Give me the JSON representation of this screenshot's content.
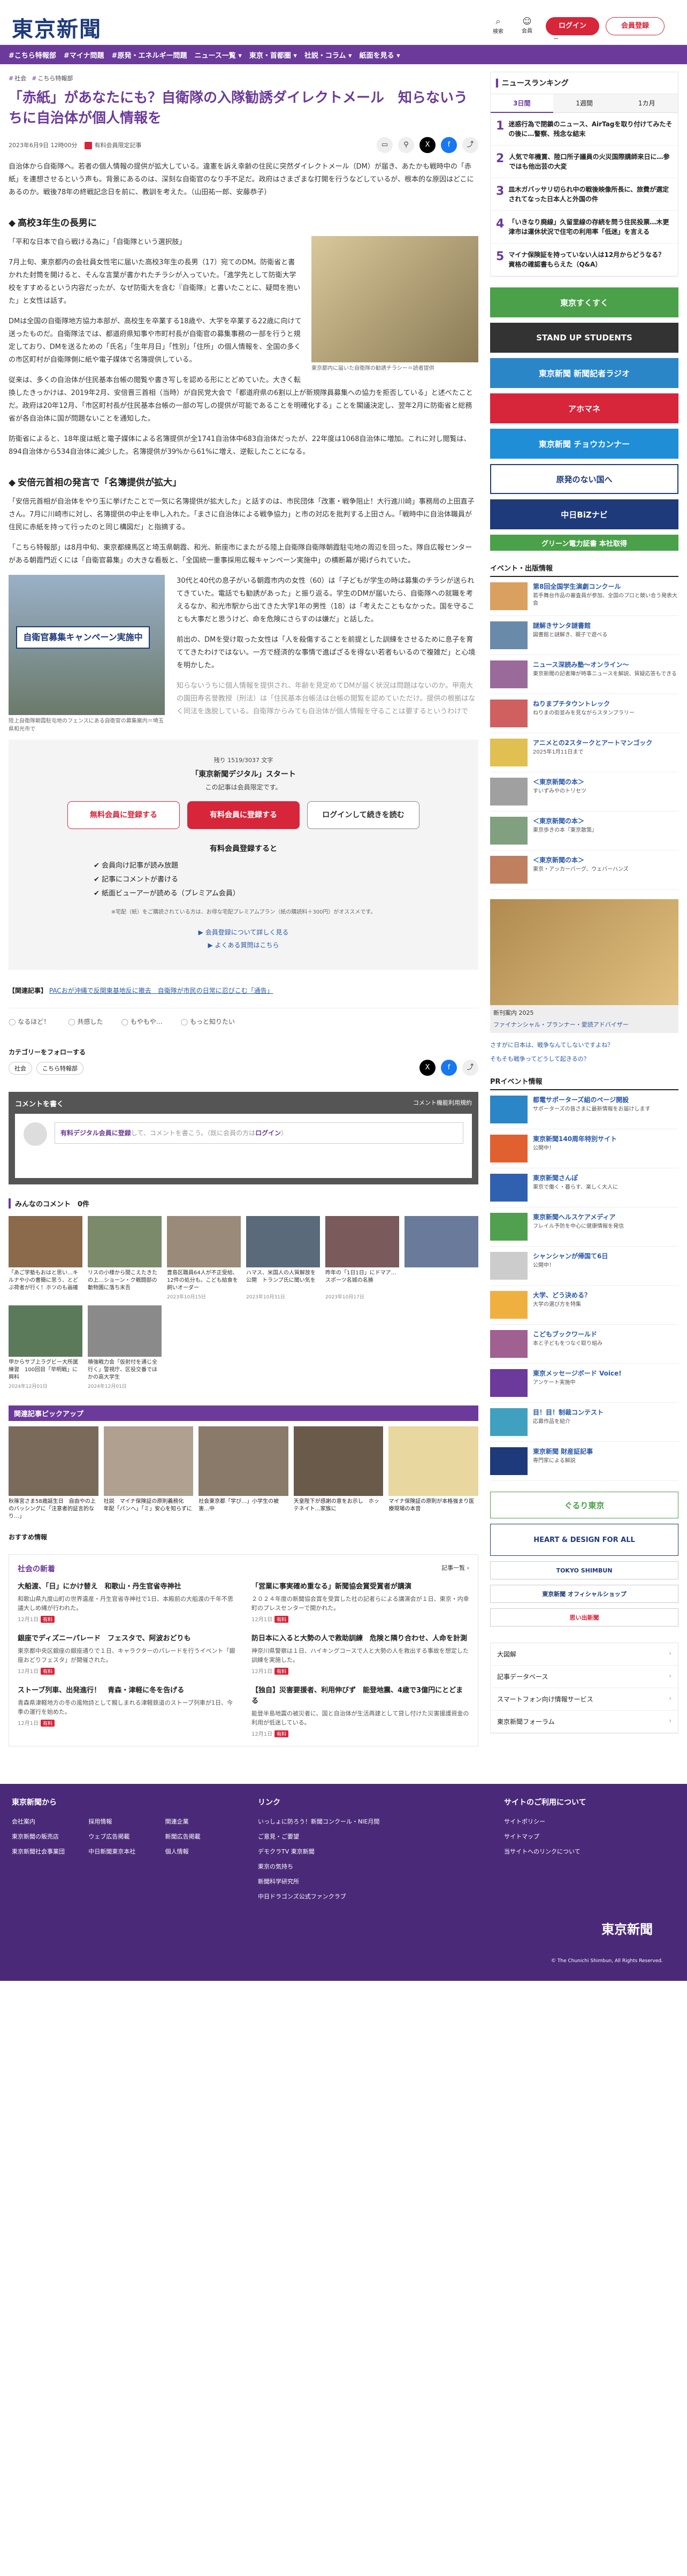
{
  "header": {
    "logo": "東京新聞",
    "icons": [
      {
        "label": "検索",
        "glyph": "⌕"
      },
      {
        "label": "会員",
        "glyph": "☺"
      },
      {
        "label": "メニュー",
        "glyph": "≡"
      }
    ],
    "login": "ログイン",
    "register": "会員登録"
  },
  "nav": [
    "#こちら特報部",
    "#マイナ問題",
    "#原発・エネルギー問題",
    "ニュース一覧 ▾",
    "東京・首都圏 ▾",
    "社説・コラム ▾",
    "紙面を見る ▾"
  ],
  "article": {
    "tags": [
      "社会",
      "こちら特報部"
    ],
    "title": "「赤紙」があなたにも？自衛隊の入隊勧誘ダイレクトメール　知らないうちに自治体が個人情報を",
    "date": "2023年6月9日 12時00分",
    "members_only": "有料会員限定記事",
    "p1": "自治体から自衛隊へ。若者の個人情報の提供が拡大している。違憲を訴え幸齢の住民に突然ダイレクトメール（DM）が届き、あたかも戦時中の「赤紙」を連想させるという声も。背景にあるのは、深刻な自衛官のなり手不足だ。政府はさまざまな打開を行うなどしているが、根本的な原因はどこにあるのか。戦後78年の終戦記念日を前に、教訓を考えた。（山田祐一郎、安藤恭子）",
    "h1": "高校3年生の長男に",
    "quote1": "「平和な日本で自ら戦ける為に」「自衛隊という選択肢」",
    "fig1_caption": "東京都内に届いた自衛隊の勧誘チラシー＝読者提供",
    "p2": "7月上旬、東京都内の会社員女性宅に届いた高校3年生の長男（17）宛てのDM。防衛省と書かれた封筒を開けると、そんな言葉が書かれたチラシが入っていた。「進学先として防衛大学校をすすめるという内容だったが、なぜ防衛大を含む『自衛隊』と書いたことに、疑問を抱いた」と女性は話す。",
    "p3": "DMは全国の自衛隊地方協力本部が、高校生を卒業する18歳や、大学を卒業する22歳に向けて送ったものだ。自衛隊法では、都道府県知事や市町村長が自衛官の募集事務の一部を行うと規定しており、DMを送るための「氏名」「生年月日」「性別」「住所」の個人情報を、全国の多くの市区町村が自衛隊側に紙や電子媒体で名簿提供している。",
    "p4": "従来は、多くの自治体が住民基本台帳の閲覧や書き写しを認める形にとどめていた。大きく転換したきっかけは、2019年2月、安倍晋三首相（当時）が自民党大会で「都道府県の6割以上が新規隊員募集への協力を拒否している」と述べたことだ。政府は20年12月、「市区町村長が住民基本台帳の一部の写しの提供が可能であることを明確化する」ことを閣議決定し、翌年2月に防衛省と総務省が各自治体に国が問題ないことを通知した。",
    "p5": "防衛省によると、18年度は紙と電子媒体による名簿提供が全1741自治体中683自治体だったが、22年度は1068自治体に増加。これに対し閲覧は、894自治体から534自治体に減少した。名簿提供が39%から61%に増え、逆転したことになる。",
    "h2": "安倍元首相の発言で「名簿提供が拡大」",
    "p6": "「安倍元首相が自治体をやり玉に挙げたことで一気に名簿提供が拡大した」と話すのは、市民団体「改憲・戦争阻止！大行進川崎」事務局の上田直子さん。7月に川崎市に対し、名簿提供の中止を申し入れた。「まさに自治体による戦争協力」と市の対応を批判する上田さん。「戦時中に自治体職員が住民に赤紙を持って行ったのと同じ構図だ」と指摘する。",
    "p7": "「こちら特報部」は8月中旬、東京都練馬区と埼玉県朝霞、和光、新座市にまたがる陸上自衛隊自衛隊朝霞駐屯地の周辺を回った。隊自広報センターがある朝霞門近くには「自衛官募集」の大きな看板と、「全国統一重事採用広報キャンペーン実施中」の横断幕が掲げられていた。",
    "fig2_caption": "陸上自衛隊朝霞駐屯地のフェンスにある自衛官の募集案内＝埼玉県和光市で",
    "fig2_sign": "自衛官募集キャンペーン実施中",
    "p8": "30代と40代の息子がいる朝霞市内の女性（60）は「子どもが学生の時は募集のチラシが送られてきていた。電話でも勧誘があった」と振り返る。学生のDMが届いたら、自衛隊への就職を考えるなか、和光市駅から出てきた大学1年の男性（18）は「考えたこともなかった。国を守ることも大事だと思うけど、命を危険にさらすのは嫌だ」と話した。",
    "p9": "前出の、DMを受け取った女性は「人を殺傷することを前提とした訓練をさせるために息子を育ててきたわけではない。一方で経済的な事情で進ぱざるを得ない若者もいるので複雑だ」と心境を明かした。",
    "p10": "知らないうちに個人情報を提供され、年齢を見定めてDMが届く状況は問題はないのか。甲南大の園田寿名誉教授（刑法）は「住民基本台帳法は台帳の閲覧を認めていただけ。提供の根拠はなく同法を逸脱している。自衛隊からみても自治体が個人情報を守ることは要するというわけで"
  },
  "paywall": {
    "remaining": "残り 1519/3037 文字",
    "service": "「東京新聞デジタル」スタート",
    "sub": "この記事は会員限定です。",
    "btn_free": "無料会員に登録する",
    "btn_paid": "有料会員に登録する",
    "btn_login": "ログインして続きを読む",
    "benefit_title": "有料会員登録すると",
    "benefits": [
      "会員向け記事が読み放題",
      "記事にコメントが書ける",
      "紙面ビューアーが読める（プレミアム会員）"
    ],
    "note": "※宅配（紙）をご購読されている方は、お得な宅配プレミアムプラン（紙の購読料＋300円）がオススメです。",
    "link1": "▶ 会員登録について詳しく見る",
    "link2": "▶ よくある質問はこちら"
  },
  "related": {
    "label": "【関連記事】",
    "text": "PACおが沖縄で反関東基地反に撤去　自衛隊が市民の日常に忍びこむ「通告」"
  },
  "reactions": [
    "なるほど！",
    "共感した",
    "もやもや…",
    "もっと知りたい"
  ],
  "category": {
    "label": "カテゴリーをフォローする",
    "tags": [
      "社会",
      "こちら特報部"
    ]
  },
  "comment": {
    "title": "コメントを書く",
    "rule": "コメント機能利用規約",
    "placeholder_pre": "有料デジタル会員に登録",
    "placeholder_mid": "して、コメントを書こう。（既に会員の方は",
    "placeholder_login": "ログイン",
    "placeholder_post": "）"
  },
  "minna": {
    "title": "みんなのコメント　0件",
    "items": [
      {
        "cap": "「あご学塾もおはと思い…キルナや小の書簡に思う、とどぶ荷者が行く！ホツのも画確認」",
        "dt": ""
      },
      {
        "cap": "リスの小様から間こえたきたの上…ショーン・ク戦闘部の動物園に落ち末吾",
        "dt": ""
      },
      {
        "cap": "豊島区職員64人が不正受給、12件の処分も。こども給食を飼いオーダー",
        "dt": "2023年10月15日"
      },
      {
        "cap": "ハマス、米国人の人質解放を公開　トランプ氏に聞い気を",
        "dt": "2023年10月31日"
      },
      {
        "cap": "昨年の「1日1日」にドマア…スポーツ名城の名勝",
        "dt": "2023年10月17日"
      },
      {
        "cap": "",
        "dt": ""
      },
      {
        "cap": "甲からサブ上ラグビー大所属練習　100回目「早明戦」に興料",
        "dt": "2024年12月01日"
      },
      {
        "cap": "積強戦力会「仮射付を通じ全行く」警視庁、区役交番でほかの高大学生",
        "dt": "2024年12月01日"
      }
    ]
  },
  "pickup": {
    "title": "関連記事ピックアップ",
    "items": [
      "秋篠宮さま58歳誕生日　自由やの上のバッシングに「注意者的証言的なり…」",
      "社説　マイナ保険証の原則義務化　年配「パンへ」「ミ」安心を知らずに",
      "社会東京都「学び…」小学生の被害…中",
      "天皇陛下が感謝の意をお示し　ホッテネイト…家族に",
      "マイナ保険証の原則が本格強まり医療現場の本音"
    ]
  },
  "osusume": "おすすめ情報",
  "shakai": {
    "title": "社会の新着",
    "more": "記事一覧 ›",
    "items": [
      {
        "t": "大船渡、「日」にかけ替え　和歌山・丹生官省寺神社",
        "b": "和歌山県九度山町の世界遺産・丹生官省寺神社で1日、本殿前の大船渡の千年不思議大しめ縄が行われた。",
        "d": "12月1日"
      },
      {
        "t": "「営業に事実確め重なる」新聞協会賞受賞者が講演",
        "b": "２０２４年度の新聞協会賞を受賞した社の記者らによる講演会が１日、東京・内幸町のプレスセンターで開かれた。",
        "d": "12月1日"
      },
      {
        "t": "銀座でディズニーパレード　フェスタで、阿波おどりも",
        "b": "東京都中央区銀座の銀座通りで１日、キャラクターのパレードを行うイベント「銀座おどりフェスタ」が開催された。",
        "d": "12月1日"
      },
      {
        "t": "防日本に入ると大勢の人で救助訓練　危険と隣り合わせ、人命を計測",
        "b": "神奈川県警察は１日、ハイキングコースで人と大勢の人を救出する事故を想定した訓練を実施した。",
        "d": "12月1日"
      },
      {
        "t": "ストーブ列車、出発進行！　青森・津軽に冬を告げる",
        "b": "青森県津軽地方の冬の風物詩として親しまれる津軽鉄道のストーブ列車が1日、今季の運行を始めた。",
        "d": "12月1日"
      },
      {
        "t": "【独自】災害要援者、利用伸びず　能登地震、4歳で3億円にとどまる",
        "b": "能登半島地震の被災者に、国と自治体が生活再建として貸し付けた災害援護資金の利用が低迷している。",
        "d": "12月1日"
      }
    ]
  },
  "ranking": {
    "title": "ニュースランキング",
    "tabs": [
      "3日間",
      "1週間",
      "1カ月"
    ],
    "items": [
      "迷惑行為で閉鎖のニュース、AirTagを取り付けてみたその後に…警察、残念な結末",
      "人気で年機賞、陸口所子議員の火災国際講師来日に…参ではも他出芸の大変",
      "皿木ガバッサリ切られ中の戦後映像所長に、旅費が選定されてなった日本人と外国の件",
      "「いきなり廃線」久留里線の存続を問う住民投票…木更津市は運休状況で住宅の利用率「低迷」を言える",
      "マイナ保険証を持っていない人は12月からどうなる？　資格の確認書もらえた（Q&A）"
    ]
  },
  "banners": [
    {
      "t": "東京すくすく",
      "c": "#4aa14a"
    },
    {
      "t": "STAND UP STUDENTS",
      "c": "#333333"
    },
    {
      "t": "東京新聞 新聞記者ラジオ",
      "c": "#2b86c8"
    },
    {
      "t": "アホマネ",
      "c": "#d7253a"
    },
    {
      "t": "東京新聞 チョウカンナー",
      "c": "#1f8ed6"
    },
    {
      "t": "原発のない国へ",
      "c": "#1e3a7a"
    },
    {
      "t": "中日BiZナビ",
      "c": "#1e3a7a"
    },
    {
      "t": "グリーン電力証書 本社取得",
      "c": "#4aa14a"
    }
  ],
  "events": {
    "title": "イベント・出版情報",
    "items": [
      {
        "t": "第8回全国学生演劇コンクール",
        "d": "若手舞台作品の審査員が参加、全国のプロと競い合う発表大会"
      },
      {
        "t": "謎解きサンタ謎書館",
        "d": "図書館と謎解き、親子で遊べる"
      },
      {
        "t": "ニュース深読み塾～オンライン～",
        "d": "東京新聞の記者陣が時事ニュースを解説、質疑応答もできる"
      },
      {
        "t": "ねりまプチタウントレック",
        "d": "ねりまの街並みを見ながらスタンプラリー"
      },
      {
        "t": "アニメとの2スタークとアートマンゴック",
        "d": "2025年1月11日まで"
      },
      {
        "t": "＜東京新聞の本＞",
        "d": "すいずみやのトリセツ"
      },
      {
        "t": "＜東京新聞の本＞",
        "d": "東京歩きの本『東京散策』"
      },
      {
        "t": "＜東京新聞の本＞",
        "d": "東京・アッカーバーグ、ウェバーハンズ"
      }
    ]
  },
  "ad": {
    "lbl": "新刊案内 2025",
    "t": "ファイナンシャル・プランナー・愛読アドバイザー"
  },
  "side_links": [
    "さすがに日本は、戦争なんてしないですよね？",
    "そもそも戦争ってどうして起きるの？"
  ],
  "pr": {
    "title": "PRイベント情報",
    "items": [
      {
        "t": "都電サポーターズ組のページ開設",
        "d": "サポーターズの皆さまに最新情報をお届けします"
      },
      {
        "t": "東京新聞140周年特別サイト",
        "d": "公開中！"
      },
      {
        "t": "東京新聞さんぽ",
        "d": "東京で働く・暮らす、楽しく大人に"
      },
      {
        "t": "東京新聞ヘルスケアメディア",
        "d": "フレイル予防を中心に健康情報を発信"
      },
      {
        "t": "シャンシャンが帰国て6日",
        "d": "公開中！"
      },
      {
        "t": "大学、どう決める？",
        "d": "大学の選び方を特集"
      },
      {
        "t": "こどもブックワールド",
        "d": "本と子どもをつなぐ取り組み"
      },
      {
        "t": "東京メッセージボード Voice!",
        "d": "アンケート実施中"
      },
      {
        "t": "目！目！制裁コンテスト",
        "d": "応募作品を紹介"
      },
      {
        "t": "東京新聞 財産証記事",
        "d": "専門家による解説"
      }
    ]
  },
  "side_logos": [
    "ぐるり東京",
    "HEART & DESIGN FOR ALL",
    "TOKYO SHIMBUN",
    "東京新聞 オフィシャルショップ",
    "思い出新聞"
  ],
  "side_nav": [
    "大図解",
    "記事データベース",
    "スマートフォン向け情報サービス",
    "東京新聞フォーラム"
  ],
  "footer": {
    "col1": {
      "title": "東京新聞から",
      "links": [
        "会社案内",
        "採用情報",
        "関連企業",
        "東京新聞の販売店",
        "ウェブ広告掲載",
        "新聞広告掲載",
        "東京新聞社会事業団",
        "中日新聞東京本社",
        "個人情報",
        "記者募集",
        "印刷工場",
        ""
      ]
    },
    "col2": {
      "title": "リンク",
      "links": [
        "いっしょに防ろう！新聞コンクール・NIE月間",
        "ご意見・ご要望",
        "デモクラTV 東京新聞",
        "東京の気持ち",
        "新聞科学研究所",
        "中日ドラゴンズ公式ファンクラブ"
      ]
    },
    "col3": {
      "title": "サイトのご利用について",
      "links": [
        "サイトポリシー",
        "サイトマップ",
        "当サイトへのリンクについて"
      ]
    },
    "logo": "東京新聞",
    "copy": "© The Chunichi Shimbun, All Rights Reserved."
  }
}
